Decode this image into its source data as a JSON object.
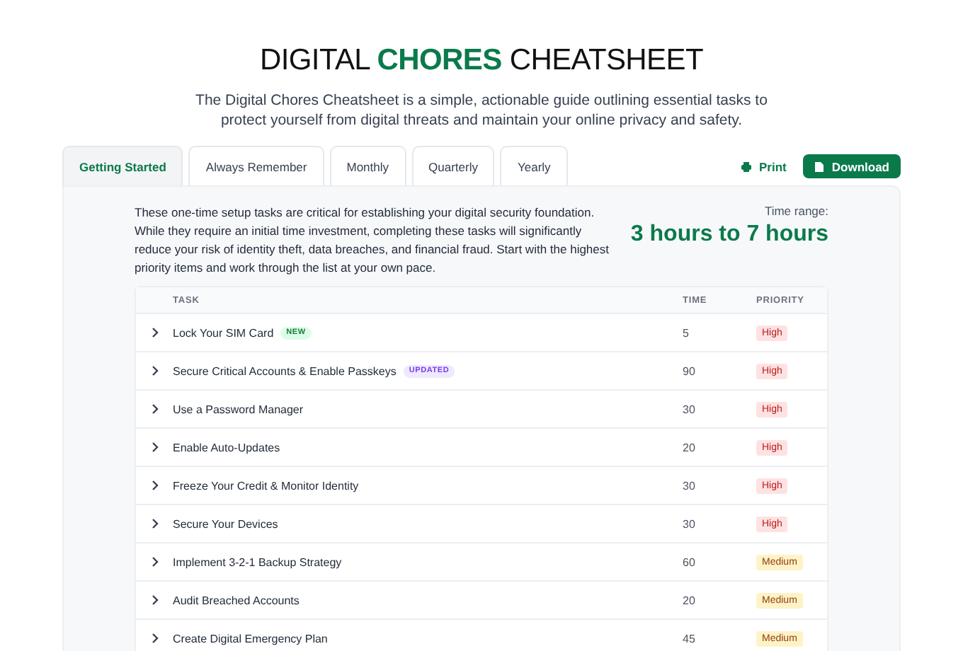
{
  "header": {
    "title": "DIGITAL **CHORES** CHEATSHEET",
    "subtitle": "The Digital Chores Cheatsheet is a simple, actionable guide outlining essential tasks to protect yourself from digital threats and maintain your online privacy and safety."
  },
  "tabs": [
    {
      "label": "Getting Started",
      "selected": true
    },
    {
      "label": "Always Remember",
      "selected": false
    },
    {
      "label": "Monthly",
      "selected": false
    },
    {
      "label": "Quarterly",
      "selected": false
    },
    {
      "label": "Yearly",
      "selected": false
    }
  ],
  "actions": {
    "print": "Print",
    "download": "Download"
  },
  "intro": {
    "text": "These one-time setup tasks are critical for establishing your digital security foundation. While they require an initial time investment, completing these tasks will significantly reduce your risk of identity theft, data breaches, and financial fraud. Start with the highest priority items and work through the list at your own pace.",
    "time_label": "Time range:",
    "time_value": "3 hours to 7 hours"
  },
  "table": {
    "columns": [
      "TASK",
      "TIME",
      "PRIORITY"
    ],
    "rows": [
      {
        "task": "Lock Your SIM Card",
        "tag": {
          "label": "NEW",
          "kind": "new"
        },
        "time": "5",
        "priority": {
          "label": "High",
          "kind": "high"
        }
      },
      {
        "task": "Secure Critical Accounts & Enable Passkeys",
        "tag": {
          "label": "UPDATED",
          "kind": "updated"
        },
        "time": "90",
        "priority": {
          "label": "High",
          "kind": "high"
        }
      },
      {
        "task": "Use a Password Manager",
        "time": "30",
        "priority": {
          "label": "High",
          "kind": "high"
        }
      },
      {
        "task": "Enable Auto-Updates",
        "time": "20",
        "priority": {
          "label": "High",
          "kind": "high"
        }
      },
      {
        "task": "Freeze Your Credit & Monitor Identity",
        "time": "30",
        "priority": {
          "label": "High",
          "kind": "high"
        }
      },
      {
        "task": "Secure Your Devices",
        "time": "30",
        "priority": {
          "label": "High",
          "kind": "high"
        }
      },
      {
        "task": "Implement 3-2-1 Backup Strategy",
        "time": "60",
        "priority": {
          "label": "Medium",
          "kind": "medium"
        }
      },
      {
        "task": "Audit Breached Accounts",
        "time": "20",
        "priority": {
          "label": "Medium",
          "kind": "medium"
        }
      },
      {
        "task": "Create Digital Emergency Plan",
        "time": "45",
        "priority": {
          "label": "Medium",
          "kind": "medium"
        }
      }
    ]
  }
}
